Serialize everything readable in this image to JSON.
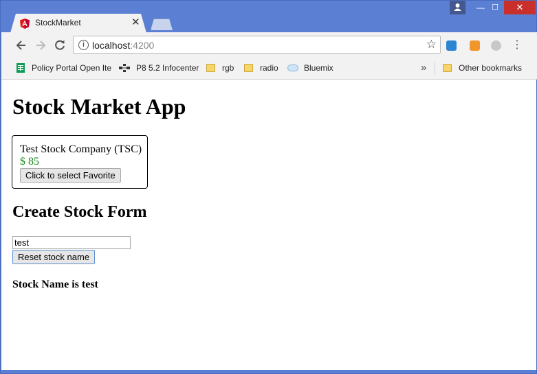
{
  "browser": {
    "tab_title": "StockMarket",
    "tab_close": "✕",
    "url_host": "localhost",
    "url_port": ":4200",
    "window_controls": {
      "minimize": "—",
      "maximize": "☐",
      "close": "✕"
    }
  },
  "bookmarks": {
    "items": [
      {
        "label": "Policy Portal Open Ite",
        "icon": "spreadsheet-icon"
      },
      {
        "label": "P8 5.2 Infocenter",
        "icon": "network-icon"
      },
      {
        "label": "rgb",
        "icon": "folder-icon"
      },
      {
        "label": "radio",
        "icon": "folder-icon"
      },
      {
        "label": "Bluemix",
        "icon": "cloud-icon"
      }
    ],
    "overflow": "»",
    "other": "Other bookmarks"
  },
  "page": {
    "title": "Stock Market App",
    "stock": {
      "name": "Test Stock Company (TSC)",
      "price": "$ 85",
      "favorite_button": "Click to select Favorite"
    },
    "form": {
      "title": "Create Stock Form",
      "input_value": "test",
      "reset_button": "Reset stock name",
      "result": "Stock Name is test"
    }
  },
  "colors": {
    "frame": "#5b7fd2",
    "price_green": "#1a8a1a",
    "close_red": "#c9302c"
  }
}
